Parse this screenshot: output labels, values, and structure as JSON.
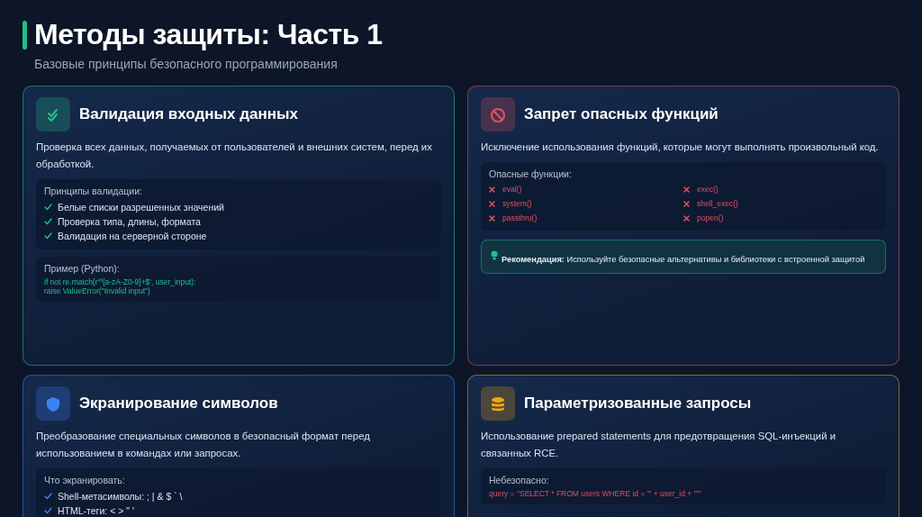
{
  "header": {
    "title": "Методы защиты: Часть 1",
    "subtitle": "Базовые принципы безопасного программирования"
  },
  "cards": [
    {
      "kind": "check",
      "color": "#22c08a",
      "title": "Валидация входных данных",
      "description": "Проверка всех данных, получаемых от пользователей и внешних систем, перед их обработкой.",
      "blocks": [
        {
          "kind": "checklist",
          "title": "Принципы валидации:",
          "items": [
            "Белые списки разрешенных значений",
            "Проверка типа, длины, формата",
            "Валидация на серверной стороне"
          ]
        },
        {
          "kind": "code_safe",
          "title": "Пример (Python):",
          "lines": [
            "if not re.match(r'^[a-zA-Z0-9]+$', user_input):",
            "raise ValueError(\"Invalid input\")"
          ]
        }
      ]
    },
    {
      "kind": "ban",
      "color": "#e0505f",
      "title": "Запрет опасных функций",
      "description": "Исключение использования функций, которые могут выполнять произвольный код.",
      "blocks": [
        {
          "kind": "x_grid",
          "title": "Опасные функции:",
          "items": [
            "eval()",
            "exec()",
            "system()",
            "shell_exec()",
            "passthru()",
            "popen()"
          ]
        },
        {
          "kind": "note",
          "text": "**Рекомендация:** Используйте безопасные альтернативы и библиотеки с встроенной защитой"
        }
      ]
    },
    {
      "kind": "shield",
      "color": "#3b82f6",
      "title": "Экранирование символов",
      "description": "Преобразование специальных символов в безопасный формат перед использованием в командах или запросах.",
      "blocks": [
        {
          "kind": "checklist",
          "title": "Что экранировать:",
          "items": [
            "Shell-метасимволы: ; | & $ ` \\",
            "HTML-теги: < > \" '"
          ]
        }
      ]
    },
    {
      "kind": "database",
      "color": "#f2a516",
      "title": "Параметризованные запросы",
      "description": "Использование prepared statements для предотвращения SQL-инъекций и связанных RCE.",
      "blocks": [
        {
          "kind": "code_unsafe",
          "title": "Небезопасно:",
          "lines": [
            "query = \"SELECT * FROM users WHERE id = '\" + user_id + \"'\""
          ]
        }
      ]
    }
  ]
}
